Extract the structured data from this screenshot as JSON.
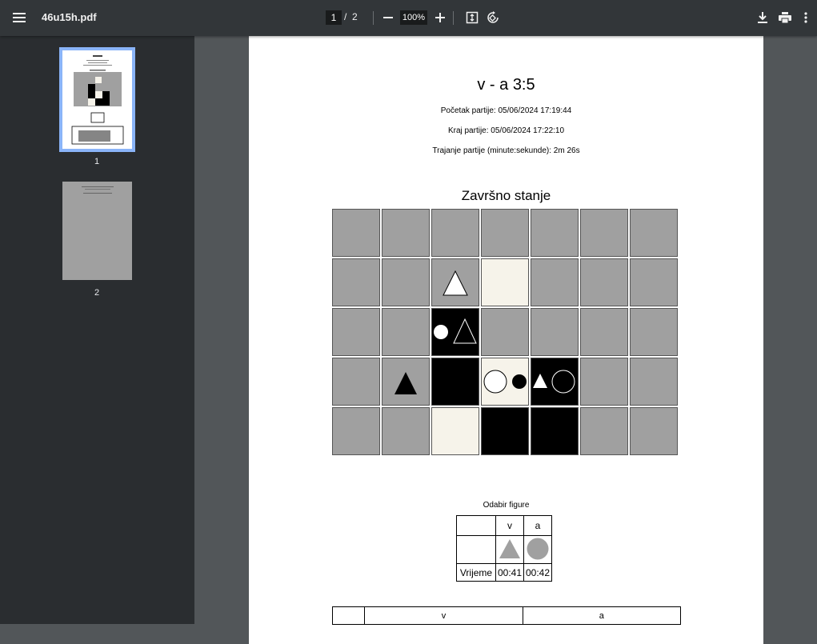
{
  "toolbar": {
    "title": "46u15h.pdf",
    "current_page": "1",
    "page_separator": "/",
    "total_pages": "2",
    "zoom": "100%",
    "zoom_out_symbol": "—",
    "zoom_in_symbol": "+"
  },
  "sidebar": {
    "thumbnails": [
      {
        "number": "1",
        "selected": true
      },
      {
        "number": "2",
        "selected": false
      }
    ]
  },
  "document": {
    "title": "v - a 3:5",
    "start": "Početak partije: 05/06/2024 17:19:44",
    "end": "Kraj partije: 05/06/2024 17:22:10",
    "duration": "Trajanje partije (minute:sekunde): 2m 26s",
    "board_title": "Završno stanje",
    "board": {
      "rows": [
        [
          "gray",
          "gray",
          "gray",
          "gray",
          "gray",
          "gray",
          "gray"
        ],
        [
          "gray",
          "gray",
          "gray",
          "cream",
          "gray",
          "gray",
          "gray"
        ],
        [
          "gray",
          "gray",
          "black",
          "gray",
          "gray",
          "gray",
          "gray"
        ],
        [
          "gray",
          "gray",
          "black",
          "cream",
          "black",
          "gray",
          "gray"
        ],
        [
          "gray",
          "gray",
          "cream",
          "black",
          "black",
          "gray",
          "gray"
        ]
      ],
      "pieces": [
        {
          "row": 1,
          "col": 2,
          "shape": "triangle",
          "style": "white-outline-black"
        },
        {
          "row": 2,
          "col": 2,
          "shape": "circle-small+triangle-outline",
          "style": "white"
        },
        {
          "row": 3,
          "col": 1,
          "shape": "triangle",
          "style": "black"
        },
        {
          "row": 3,
          "col": 3,
          "shape": "circle-large+circle-small",
          "style": "white-black"
        },
        {
          "row": 3,
          "col": 4,
          "shape": "triangle+circle-outline",
          "style": "white"
        }
      ],
      "colors": {
        "gray": "#a0a0a0",
        "cream": "#f6f3ea",
        "black": "#000000"
      }
    },
    "selection": {
      "caption": "Odabir figure",
      "headers": [
        "",
        "v",
        "a"
      ],
      "figures": [
        "",
        "triangle",
        "circle"
      ],
      "time_label": "Vrijeme",
      "times": [
        "00:41",
        "00:42"
      ],
      "figure_color": "#a0a0a0"
    },
    "moves_table": {
      "headers": [
        "",
        "v",
        "a"
      ]
    }
  }
}
